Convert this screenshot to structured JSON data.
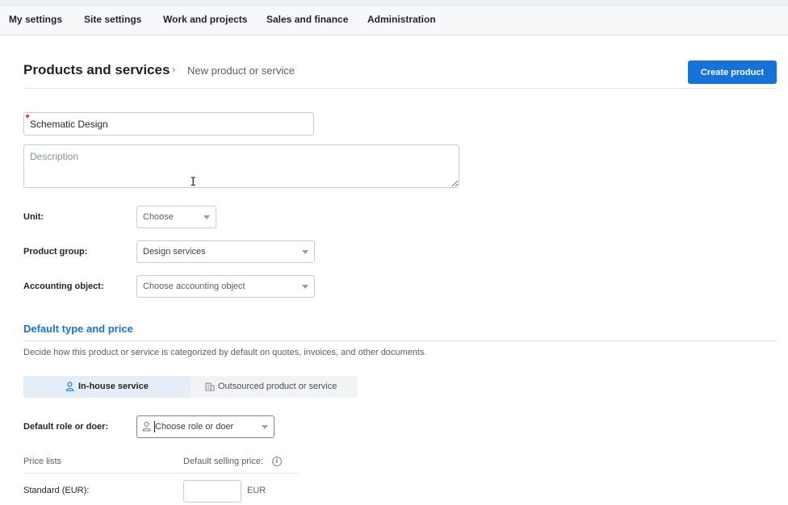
{
  "topnav": {
    "items": [
      {
        "label": "My settings"
      },
      {
        "label": "Site settings"
      },
      {
        "label": "Work and projects"
      },
      {
        "label": "Sales and finance"
      },
      {
        "label": "Administration"
      }
    ]
  },
  "header": {
    "breadcrumb_root": "Products and services",
    "breadcrumb_separator": "›",
    "breadcrumb_current": "New product or service",
    "create_button": "Create product"
  },
  "form": {
    "name_value": "Schematic Design",
    "description_placeholder": "Description",
    "unit_label": "Unit:",
    "unit_value": "Choose",
    "product_group_label": "Product group:",
    "product_group_value": "Design services",
    "accounting_object_label": "Accounting object:",
    "accounting_object_value": "Choose accounting object"
  },
  "default_type": {
    "title": "Default type and price",
    "description": "Decide how this product or service is categorized by default on quotes, invoices, and other documents.",
    "option_inhouse": "In-house service",
    "option_outsourced": "Outsourced product or service",
    "active_option": "In-house service",
    "role_label": "Default role or doer:",
    "role_placeholder": "Choose role or doer"
  },
  "price_lists": {
    "header_left": "Price lists",
    "header_right": "Default selling price:",
    "info_glyph": "i",
    "rows": [
      {
        "label": "Standard (EUR):",
        "value": "",
        "currency": "EUR"
      }
    ]
  },
  "colors": {
    "accent": "#1572d9",
    "required": "#d9443a"
  }
}
